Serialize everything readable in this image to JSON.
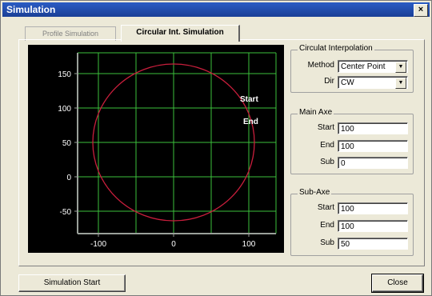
{
  "window": {
    "title": "Simulation",
    "close_glyph": "×"
  },
  "tabs": [
    {
      "label": "Profile Simulation",
      "active": false
    },
    {
      "label": "Circular Int. Simulation",
      "active": true
    }
  ],
  "plot": {
    "y_ticks": [
      "150",
      "100",
      "50",
      "0",
      "-50"
    ],
    "x_ticks": [
      "-100",
      "0",
      "100"
    ],
    "start_label": "Start",
    "end_label": "End",
    "colors": {
      "background": "#000000",
      "grid": "#3cc03c",
      "axes": "#9aa09a",
      "circle": "#c81e3c",
      "text": "#ffffff"
    }
  },
  "circular_interpolation": {
    "legend": "Circulat Interpolation",
    "method_label": "Method",
    "method_value": "Center Point",
    "dir_label": "Dir",
    "dir_value": "CW"
  },
  "main_axe": {
    "legend": "Main Axe",
    "start_label": "Start",
    "start_value": "100",
    "end_label": "End",
    "end_value": "100",
    "sub_label": "Sub",
    "sub_value": "0"
  },
  "sub_axe": {
    "legend": "Sub-Axe",
    "start_label": "Start",
    "start_value": "100",
    "end_label": "End",
    "end_value": "100",
    "sub_label": "Sub",
    "sub_value": "50"
  },
  "buttons": {
    "simulation_start": "Simulation Start",
    "close": "Close"
  },
  "icons": {
    "dropdown": "chevron-down-icon",
    "close": "close-icon"
  }
}
